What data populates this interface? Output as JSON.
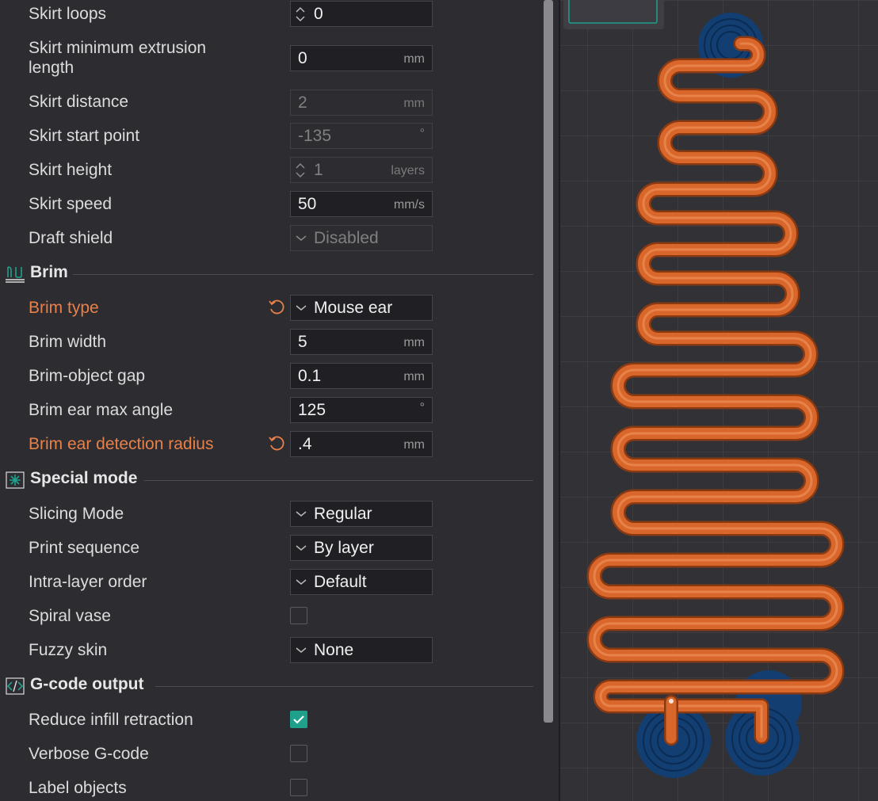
{
  "skirt": {
    "loops": {
      "label": "Skirt loops",
      "value": "0"
    },
    "min_extrusion": {
      "label_line1": "Skirt minimum extrusion",
      "label_line2": "length",
      "value": "0",
      "unit": "mm"
    },
    "distance": {
      "label": "Skirt distance",
      "value": "2",
      "unit": "mm"
    },
    "start_point": {
      "label": "Skirt start point",
      "value": "-135",
      "unit": "°"
    },
    "height": {
      "label": "Skirt height",
      "value": "1",
      "unit": "layers"
    },
    "speed": {
      "label": "Skirt speed",
      "value": "50",
      "unit": "mm/s"
    },
    "draft_shield": {
      "label": "Draft shield",
      "value": "Disabled"
    }
  },
  "brim": {
    "title": "Brim",
    "type": {
      "label": "Brim type",
      "value": "Mouse ear"
    },
    "width": {
      "label": "Brim width",
      "value": "5",
      "unit": "mm"
    },
    "object_gap": {
      "label": "Brim-object gap",
      "value": "0.1",
      "unit": "mm"
    },
    "ear_max_angle": {
      "label": "Brim ear max angle",
      "value": "125",
      "unit": "°"
    },
    "ear_detection_radius": {
      "label": "Brim ear detection radius",
      "value": ".4",
      "unit": "mm"
    }
  },
  "special_mode": {
    "title": "Special mode",
    "slicing_mode": {
      "label": "Slicing Mode",
      "value": "Regular"
    },
    "print_sequence": {
      "label": "Print sequence",
      "value": "By layer"
    },
    "intra_layer_order": {
      "label": "Intra-layer order",
      "value": "Default"
    },
    "spiral_vase": {
      "label": "Spiral vase",
      "checked": false
    },
    "fuzzy_skin": {
      "label": "Fuzzy skin",
      "value": "None"
    }
  },
  "gcode_output": {
    "title": "G-code output",
    "reduce_infill_retraction": {
      "label": "Reduce infill retraction",
      "checked": true
    },
    "verbose_gcode": {
      "label": "Verbose G-code",
      "checked": false
    },
    "label_objects": {
      "label": "Label objects",
      "checked": false
    }
  },
  "colors": {
    "accent": "#1fa08c",
    "modified": "#e8804a",
    "toolpath": "#d9662a",
    "brim_ear": "#123e72",
    "background": "#2d2d31"
  }
}
